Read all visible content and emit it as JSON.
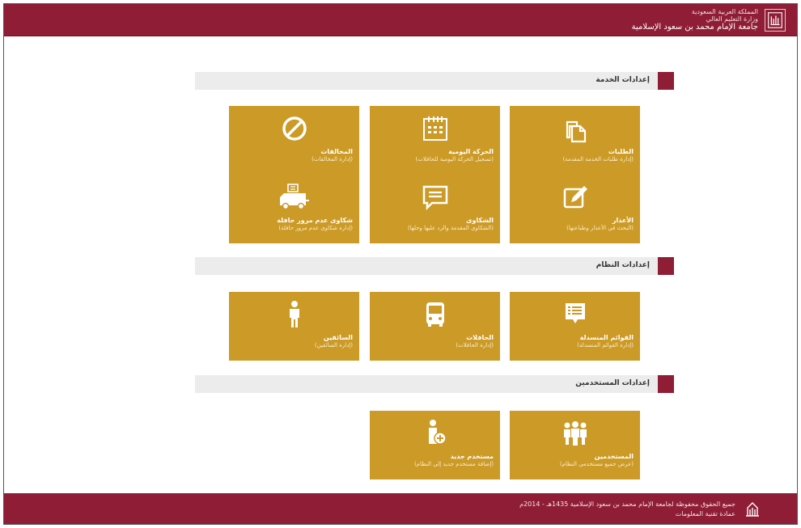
{
  "header": {
    "line1": "المملكة العربية السعودية",
    "line2": "وزارة التعليم العالي",
    "university": "جامعة الإمام محمد بن سعود الإسلامية"
  },
  "sections": [
    {
      "title": "إعدادات الخدمة",
      "tiles": [
        {
          "title": "الطلبات",
          "subtitle": "(إدارة طلبات الخدمة المقدمة)",
          "icon": "documents-icon"
        },
        {
          "title": "الحركة اليومية",
          "subtitle": "(تسجيل الحركة اليومية للحافلات)",
          "icon": "calendar-icon"
        },
        {
          "title": "المخالفات",
          "subtitle": "(إدارة المخالفات)",
          "icon": "prohibited-icon"
        },
        {
          "title": "الأعذار",
          "subtitle": "(البحث في الأعذار وطباعتها)",
          "icon": "edit-icon"
        },
        {
          "title": "الشكاوى",
          "subtitle": "(الشكاوى المقدمة والرد عليها وحلها)",
          "icon": "chat-icon"
        },
        {
          "title": "شكاوى عدم مرور حافلة",
          "subtitle": "(إدارة شكاوى عدم مرور حافلة)",
          "icon": "truck-icon"
        }
      ]
    },
    {
      "title": "إعدادات النظام",
      "tiles": [
        {
          "title": "القوائم المنسدلة",
          "subtitle": "(إدارة القوائم المنسدلة)",
          "icon": "list-icon"
        },
        {
          "title": "الحافلات",
          "subtitle": "(إدارة الحافلات)",
          "icon": "bus-icon"
        },
        {
          "title": "السائقين",
          "subtitle": "(إدارة السائقين)",
          "icon": "person-icon"
        }
      ]
    },
    {
      "title": "إعدادات المستخدمين",
      "tiles": [
        {
          "title": "المستخدمين",
          "subtitle": "(عرض جميع مستخدمي النظام)",
          "icon": "users-icon"
        },
        {
          "title": "مستخدم جديد",
          "subtitle": "(إضافة مستخدم جديد إلى النظام)",
          "icon": "add-user-icon"
        }
      ]
    }
  ],
  "footer": {
    "copyright": "جميع الحقوق محفوظة لجامعة الإمام محمد بن سعود الإسلامية 1435هـ - 2014م",
    "department": "عمادة تقنية المعلومات"
  },
  "colors": {
    "brand": "#8f1d35",
    "tile": "#cc9a26",
    "section_bar": "#ececec"
  }
}
